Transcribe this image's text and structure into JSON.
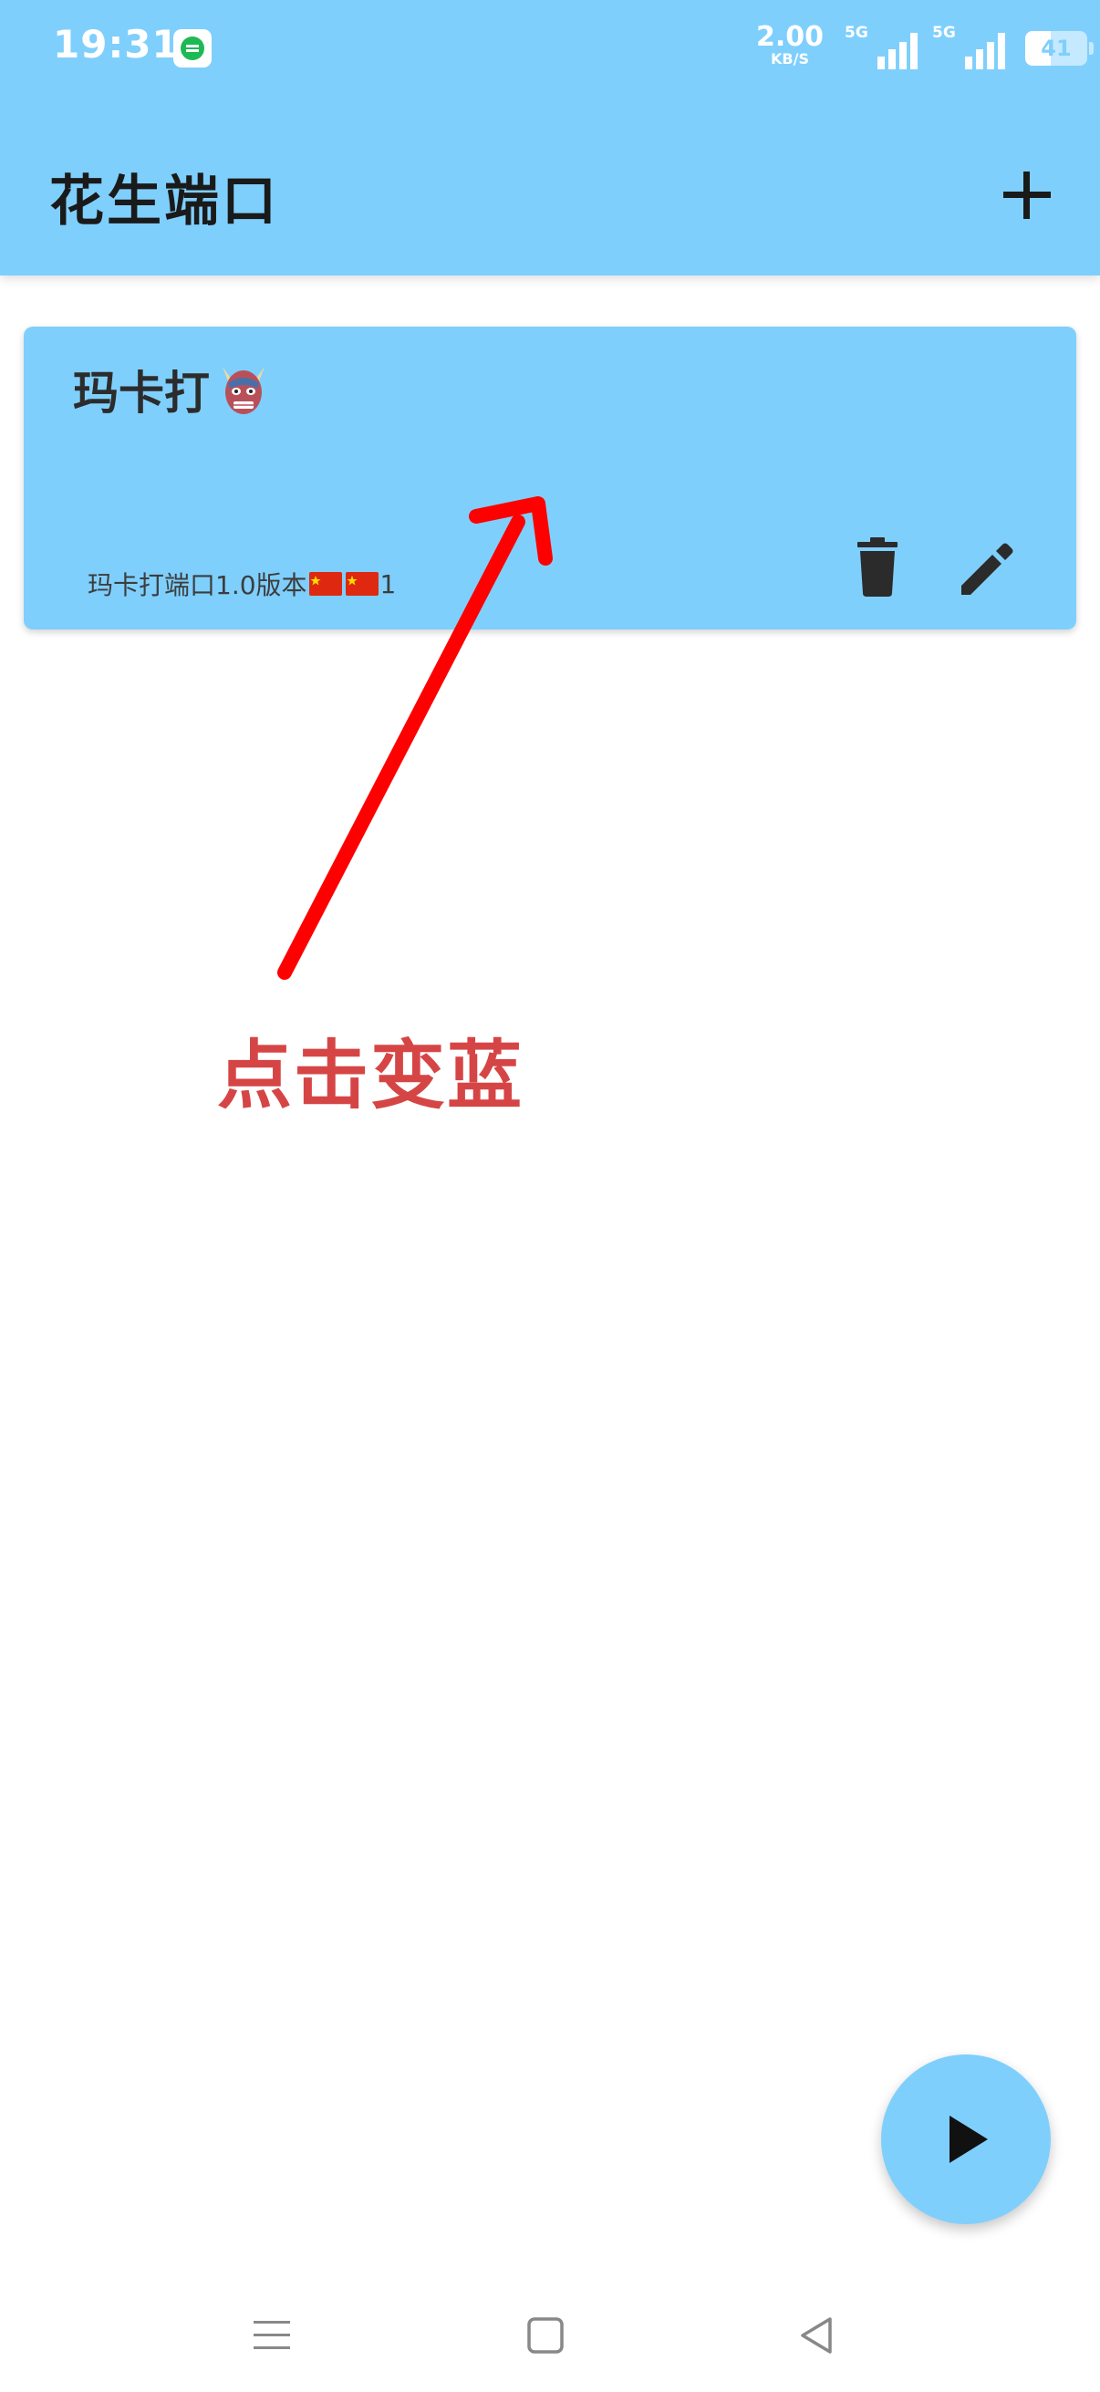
{
  "status_bar": {
    "time": "19:31",
    "network_speed": "2.00",
    "network_speed_unit": "KB/S",
    "sim1_label": "5G",
    "sim2_label": "5G",
    "battery_level": "41",
    "battery_fraction": 0.41,
    "notification_icon": "chat-bubble-icon"
  },
  "app_bar": {
    "title": "花生端口",
    "add_icon": "plus-icon"
  },
  "cards": [
    {
      "title": "玛卡打",
      "title_icon": "demon-mask-icon",
      "description_prefix": "玛卡打端口1.0版本",
      "description_suffix": "1",
      "description_icons": [
        "china-flag-icon",
        "china-flag-icon"
      ],
      "delete_icon": "trash-icon",
      "edit_icon": "pencil-icon"
    }
  ],
  "annotation": {
    "text": "点击变蓝",
    "color": "#d64545"
  },
  "fab": {
    "icon": "play-icon"
  },
  "nav_bar": {
    "menu_icon": "menu-icon",
    "home_icon": "square-home-icon",
    "back_icon": "triangle-back-icon"
  },
  "colors": {
    "primary": "#7fcffd",
    "background": "#ffffff",
    "text_dark": "#1a1a1a",
    "annotation_red": "#ff0000"
  }
}
